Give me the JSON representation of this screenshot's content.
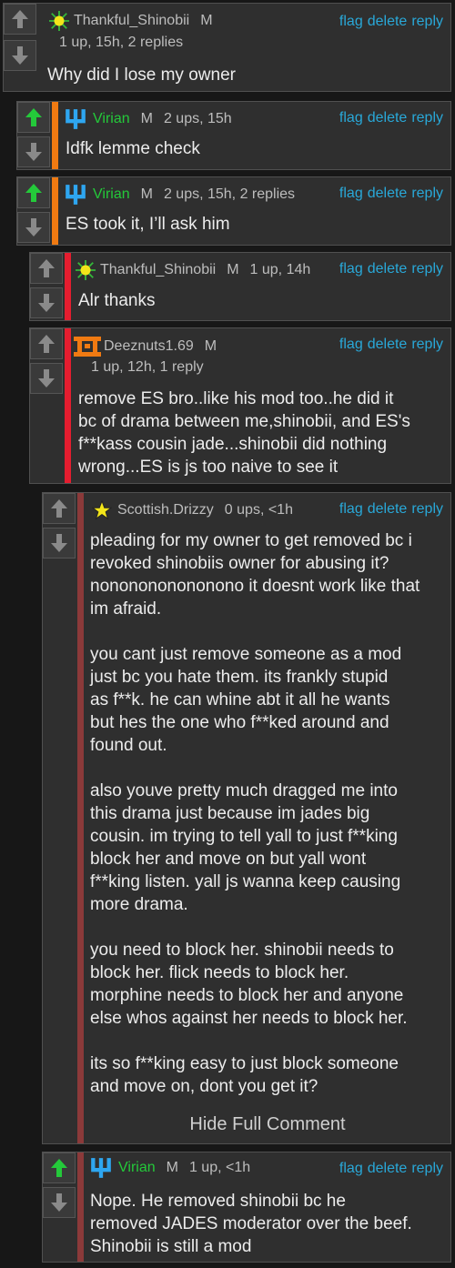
{
  "actions": {
    "flag": "flag",
    "delete": "delete",
    "reply": "reply"
  },
  "colors": {
    "upvote_active": "#24c93a",
    "depth2_bar": "#f07a12",
    "depth3_bar": "#e51d2f",
    "depth5_bar": "#8b3a3a",
    "link": "#29a8d8"
  },
  "comments": [
    {
      "username": "Thankful_Shinobii",
      "gender": "M",
      "avatar": "sun-avatar",
      "meta": "1 up, 15h, 2 replies",
      "body": "Why did I lose my owner"
    },
    {
      "username": "Virian",
      "gender": "M",
      "avatar": "virian-avatar",
      "meta": "2 ups, 15h",
      "upvoted": true,
      "body": "Idfk lemme check"
    },
    {
      "username": "Virian",
      "gender": "M",
      "avatar": "virian-avatar",
      "meta": "2 ups, 15h, 2 replies",
      "upvoted": true,
      "body": "ES took it, I’ll ask him"
    },
    {
      "username": "Thankful_Shinobii",
      "gender": "M",
      "avatar": "sun-avatar",
      "meta": "1 up, 14h",
      "body": "Alr thanks"
    },
    {
      "username": "Deeznuts1.69",
      "gender": "M",
      "avatar": "deeznuts-avatar",
      "meta": "1 up, 12h, 1 reply",
      "body": "remove ES bro..like his mod too..he did it\nbc of drama between me,shinobii, and ES's\nf**kass cousin jade...shinobii did nothing\nwrong...ES is js too naive to see it"
    },
    {
      "username": "Scottish.Drizzy",
      "gender": "",
      "avatar": "star-avatar",
      "meta": "0 ups, <1h",
      "body": "pleading for my owner to get removed bc i\nrevoked shinobiis owner for abusing it?\nnononononononono it doesnt work like that\nim afraid.\n\nyou cant just remove someone as a mod\njust bc you hate them. its frankly stupid\nas f**k. he can whine abt it all he wants\nbut hes the one who f**ked around and\nfound out.\n\nalso youve pretty much dragged me into\nthis drama just because im jades big\ncousin. im trying to tell yall to just f**king\nblock her and move on but yall wont\nf**king listen. yall js wanna keep causing\nmore drama.\n\nyou need to block her. shinobii needs to\nblock her. flick needs to block her.\nmorphine needs to block her and anyone\nelse whos against her needs to block her.\n\nits so f**king easy to just block someone\nand move on, dont you get it?",
      "hide_label": "Hide Full Comment"
    },
    {
      "username": "Virian",
      "gender": "M",
      "avatar": "virian-avatar",
      "meta": "1 up, <1h",
      "upvoted": true,
      "body": "Nope. He removed shinobii bc he\nremoved JADES moderator over the beef.\nShinobii is still a mod"
    }
  ]
}
